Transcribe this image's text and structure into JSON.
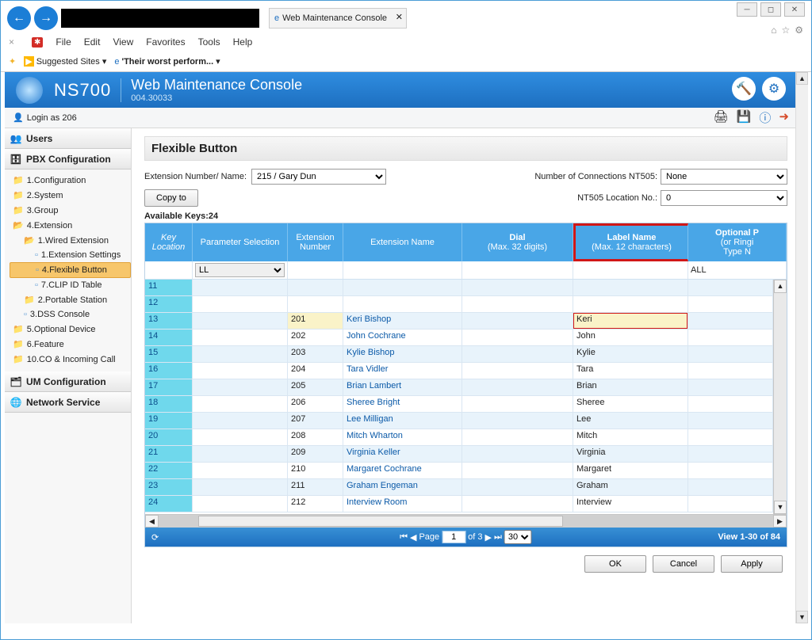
{
  "window": {
    "tab_title": "Web Maintenance Console"
  },
  "ie_menu": [
    "File",
    "Edit",
    "View",
    "Favorites",
    "Tools",
    "Help"
  ],
  "fav_bar": {
    "suggested": "Suggested Sites",
    "worst": "'Their worst perform..."
  },
  "banner": {
    "model": "NS700",
    "title": "Web Maintenance Console",
    "version": "004.30033"
  },
  "toolbar": {
    "login": "Login as 206"
  },
  "sidebar": {
    "users": "Users",
    "pbx": "PBX Configuration",
    "um": "UM Configuration",
    "net": "Network Service",
    "tree": {
      "n1": "1.Configuration",
      "n2": "2.System",
      "n3": "3.Group",
      "n4": "4.Extension",
      "n4_1": "1.Wired Extension",
      "n4_1_1": "1.Extension Settings",
      "n4_1_4": "4.Flexible Button",
      "n4_1_7": "7.CLIP ID Table",
      "n4_2": "2.Portable Station",
      "n4_3": "3.DSS Console",
      "n5": "5.Optional Device",
      "n6": "6.Feature",
      "n10": "10.CO & Incoming Call"
    }
  },
  "page": {
    "title": "Flexible Button",
    "ext_label": "Extension Number/ Name:",
    "ext_value": "215 / Gary Dun",
    "conn_label": "Number of Connections NT505:",
    "conn_value": "None",
    "loc_label": "NT505 Location No.:",
    "loc_value": "0",
    "copy_btn": "Copy to",
    "avail": "Available Keys:24"
  },
  "columns": {
    "key": "Key Location",
    "param": "Parameter Selection",
    "extnum": "Extension Number",
    "extname": "Extension Name",
    "dial": "Dial\n(Max. 32 digits)",
    "dial1": "Dial",
    "dial2": "(Max. 32 digits)",
    "label": "Label Name",
    "label2": "(Max. 12 characters)",
    "opt1": "Optional P",
    "opt2": "(or Ringi",
    "opt3": "Type N"
  },
  "filter": {
    "ll": "LL",
    "all": "ALL"
  },
  "rows": [
    {
      "key": "11",
      "extnum": "",
      "extname": "",
      "label": ""
    },
    {
      "key": "12",
      "extnum": "",
      "extname": "",
      "label": ""
    },
    {
      "key": "13",
      "extnum": "201",
      "extname": "Keri Bishop",
      "label": "Keri",
      "edit": true
    },
    {
      "key": "14",
      "extnum": "202",
      "extname": "John Cochrane",
      "label": "John"
    },
    {
      "key": "15",
      "extnum": "203",
      "extname": "Kylie Bishop",
      "label": "Kylie"
    },
    {
      "key": "16",
      "extnum": "204",
      "extname": "Tara Vidler",
      "label": "Tara"
    },
    {
      "key": "17",
      "extnum": "205",
      "extname": "Brian Lambert",
      "label": "Brian"
    },
    {
      "key": "18",
      "extnum": "206",
      "extname": "Sheree Bright",
      "label": "Sheree"
    },
    {
      "key": "19",
      "extnum": "207",
      "extname": "Lee Milligan",
      "label": "Lee"
    },
    {
      "key": "20",
      "extnum": "208",
      "extname": "Mitch Wharton",
      "label": "Mitch"
    },
    {
      "key": "21",
      "extnum": "209",
      "extname": "Virginia Keller",
      "label": "Virginia"
    },
    {
      "key": "22",
      "extnum": "210",
      "extname": "Margaret Cochrane",
      "label": "Margaret"
    },
    {
      "key": "23",
      "extnum": "211",
      "extname": "Graham Engeman",
      "label": "Graham"
    },
    {
      "key": "24",
      "extnum": "212",
      "extname": "Interview Room",
      "label": "Interview"
    }
  ],
  "pager": {
    "page_lbl": "Page",
    "page_val": "1",
    "of": "of 3",
    "size": "30",
    "view": "View 1-30 of 84"
  },
  "actions": {
    "ok": "OK",
    "cancel": "Cancel",
    "apply": "Apply"
  }
}
